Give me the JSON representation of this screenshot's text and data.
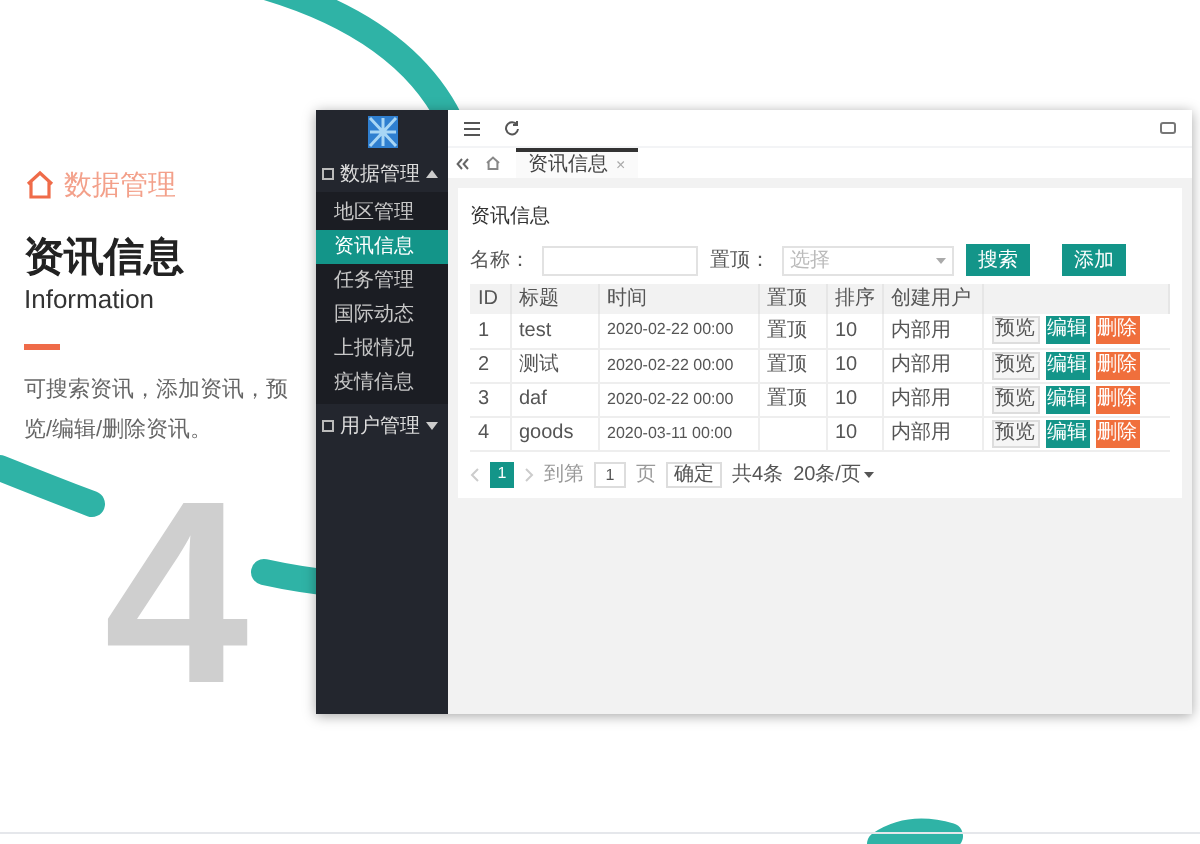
{
  "slide": {
    "section_label": "数据管理",
    "title": "资讯信息",
    "subtitle": "Information",
    "description": "可搜索资讯，添加资讯，预览/编辑/删除资讯。",
    "page_number": "4"
  },
  "app": {
    "sidebar": {
      "groups": [
        {
          "label": "数据管理",
          "expanded": true,
          "children": [
            {
              "label": "地区管理",
              "selected": false
            },
            {
              "label": "资讯信息",
              "selected": true
            },
            {
              "label": "任务管理",
              "selected": false
            },
            {
              "label": "国际动态",
              "selected": false
            },
            {
              "label": "上报情况",
              "selected": false
            },
            {
              "label": "疫情信息",
              "selected": false
            }
          ]
        },
        {
          "label": "用户管理",
          "expanded": false
        }
      ]
    },
    "tabs": [
      {
        "label": "资讯信息",
        "selected": true,
        "close": "×"
      }
    ],
    "panel_title": "资讯信息",
    "filters": [
      {
        "kind": "text",
        "label": "名称："
      },
      {
        "kind": "select",
        "label": "置顶：",
        "placeholder": "选择"
      }
    ],
    "buttons": [
      "搜索",
      "添加"
    ],
    "table": {
      "columns": [
        "ID",
        "标题",
        "时间",
        "置顶",
        "排序",
        "创建用户",
        ""
      ],
      "rows": [
        {
          "cells": [
            "1",
            "test",
            "2020-02-22 00:00",
            "置顶",
            "10",
            "内部用"
          ],
          "actions": [
            {
              "label": "预览",
              "kind": "plain"
            },
            {
              "label": "编辑",
              "kind": "primary"
            },
            {
              "label": "删除",
              "kind": "danger"
            }
          ]
        },
        {
          "cells": [
            "2",
            "测试",
            "2020-02-22 00:00",
            "置顶",
            "10",
            "内部用"
          ],
          "actions": [
            {
              "label": "预览",
              "kind": "plain"
            },
            {
              "label": "编辑",
              "kind": "primary"
            },
            {
              "label": "删除",
              "kind": "danger"
            }
          ]
        },
        {
          "cells": [
            "3",
            "daf",
            "2020-02-22 00:00",
            "置顶",
            "10",
            "内部用"
          ],
          "actions": [
            {
              "label": "预览",
              "kind": "plain"
            },
            {
              "label": "编辑",
              "kind": "primary"
            },
            {
              "label": "删除",
              "kind": "danger"
            }
          ]
        },
        {
          "cells": [
            "4",
            "goods",
            "2020-03-11 00:00",
            "",
            "10",
            "内部用"
          ],
          "actions": [
            {
              "label": "预览",
              "kind": "plain"
            },
            {
              "label": "编辑",
              "kind": "primary"
            },
            {
              "label": "删除",
              "kind": "danger"
            }
          ]
        }
      ]
    },
    "pagination": {
      "pages": [
        {
          "label": "1",
          "selected": true
        }
      ],
      "goto_label": "到第",
      "goto_value": "1",
      "page_unit": "页",
      "confirm": "确定",
      "total": "共4条",
      "page_size": "20条/页"
    }
  }
}
